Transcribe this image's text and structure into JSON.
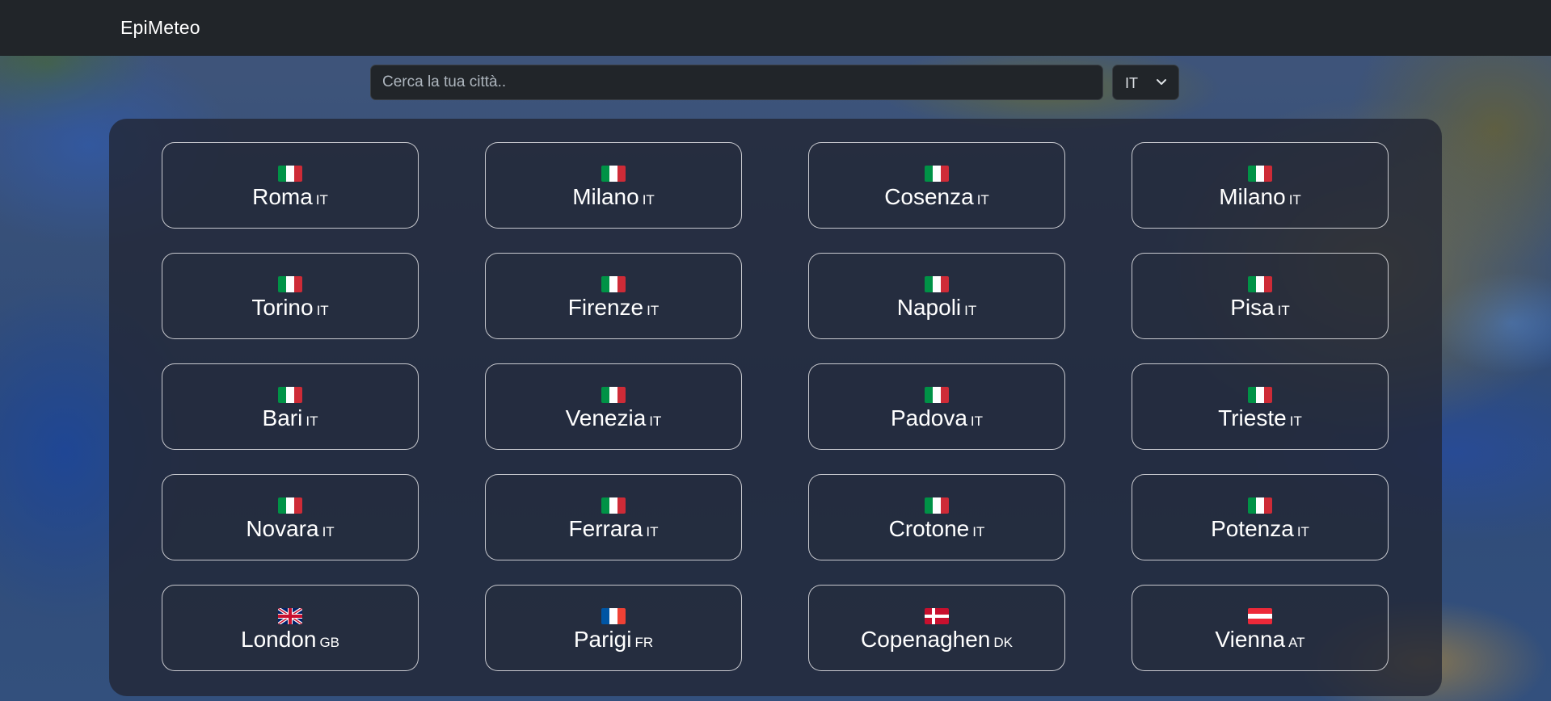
{
  "app": {
    "brand": "EpiMeteo"
  },
  "search": {
    "placeholder": "Cerca la tua città..",
    "value": ""
  },
  "country_select": {
    "selected": "IT"
  },
  "cities": [
    {
      "name": "Roma",
      "code": "IT",
      "flag": "it"
    },
    {
      "name": "Milano",
      "code": "IT",
      "flag": "it"
    },
    {
      "name": "Cosenza",
      "code": "IT",
      "flag": "it"
    },
    {
      "name": "Milano",
      "code": "IT",
      "flag": "it"
    },
    {
      "name": "Torino",
      "code": "IT",
      "flag": "it"
    },
    {
      "name": "Firenze",
      "code": "IT",
      "flag": "it"
    },
    {
      "name": "Napoli",
      "code": "IT",
      "flag": "it"
    },
    {
      "name": "Pisa",
      "code": "IT",
      "flag": "it"
    },
    {
      "name": "Bari",
      "code": "IT",
      "flag": "it"
    },
    {
      "name": "Venezia",
      "code": "IT",
      "flag": "it"
    },
    {
      "name": "Padova",
      "code": "IT",
      "flag": "it"
    },
    {
      "name": "Trieste",
      "code": "IT",
      "flag": "it"
    },
    {
      "name": "Novara",
      "code": "IT",
      "flag": "it"
    },
    {
      "name": "Ferrara",
      "code": "IT",
      "flag": "it"
    },
    {
      "name": "Crotone",
      "code": "IT",
      "flag": "it"
    },
    {
      "name": "Potenza",
      "code": "IT",
      "flag": "it"
    },
    {
      "name": "London",
      "code": "GB",
      "flag": "gb"
    },
    {
      "name": "Parigi",
      "code": "FR",
      "flag": "fr"
    },
    {
      "name": "Copenaghen",
      "code": "DK",
      "flag": "dk"
    },
    {
      "name": "Vienna",
      "code": "AT",
      "flag": "at"
    }
  ],
  "colors": {
    "navbar": "#212529",
    "card_border": "#ffffff",
    "panel": "#212533"
  }
}
